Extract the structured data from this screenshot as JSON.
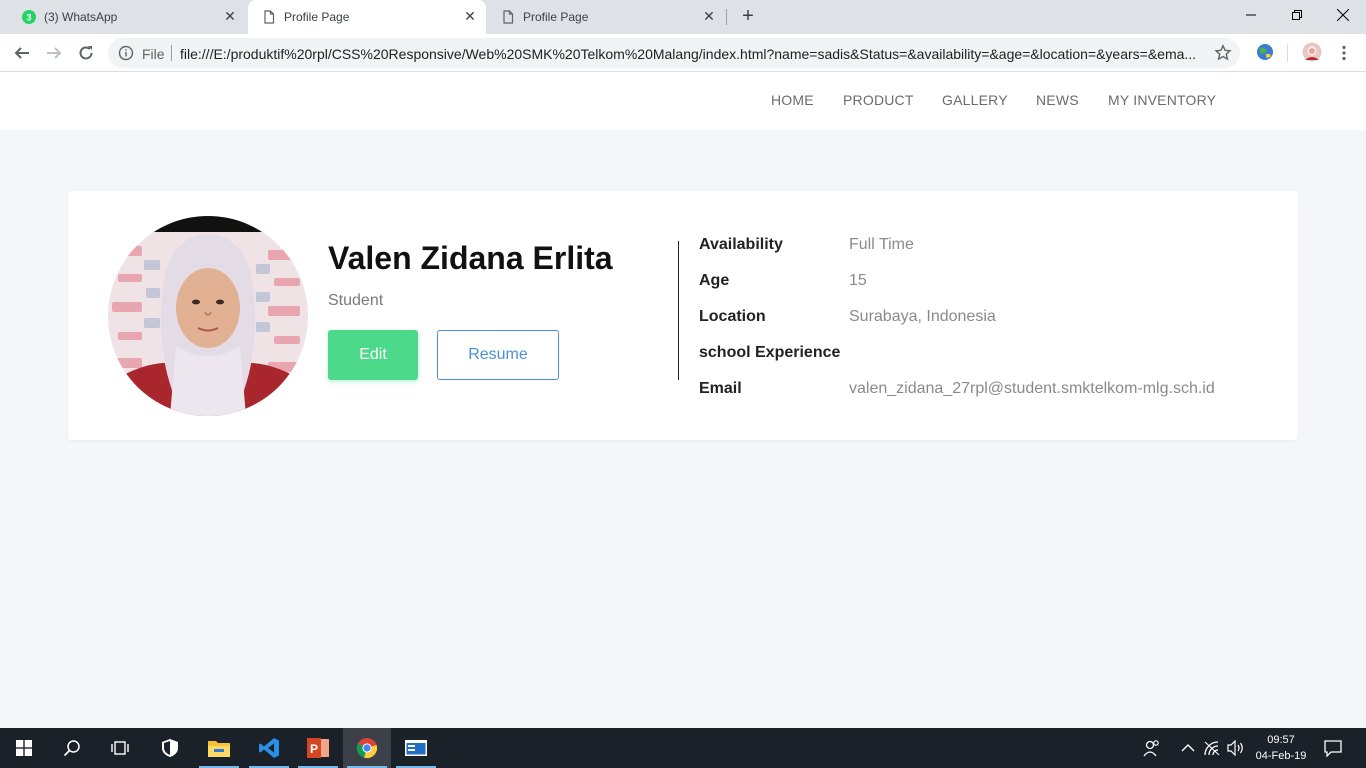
{
  "browser": {
    "tabs": [
      {
        "label": "(3) WhatsApp",
        "badge": "3",
        "active": false
      },
      {
        "label": "Profile Page",
        "active": true
      },
      {
        "label": "Profile Page",
        "active": false
      }
    ],
    "address": {
      "scheme_label": "File",
      "url": "file:///E:/produktif%20rpl/CSS%20Responsive/Web%20SMK%20Telkom%20Malang/index.html?name=sadis&Status=&availability=&age=&location=&years=&ema..."
    },
    "window_controls": [
      "minimize-icon",
      "restore-icon",
      "close-icon"
    ]
  },
  "nav": {
    "links": [
      "HOME",
      "PRODUCT",
      "GALLERY",
      "NEWS",
      "MY INVENTORY"
    ]
  },
  "profile": {
    "name": "Valen Zidana Erlita",
    "role": "Student",
    "edit_label": "Edit",
    "resume_label": "Resume",
    "info": [
      {
        "label": "Availability",
        "value": "Full Time"
      },
      {
        "label": "Age",
        "value": "15"
      },
      {
        "label": "Location",
        "value": "Surabaya, Indonesia"
      },
      {
        "label": "school Experience",
        "value": ""
      },
      {
        "label": "Email",
        "value": "valen_zidana_27rpl@student.smktelkom-mlg.sch.id"
      }
    ]
  },
  "taskbar": {
    "apps": [
      "windows-start-icon",
      "search-icon",
      "task-view-icon",
      "windows-security-icon",
      "file-explorer-icon",
      "vscode-icon",
      "powerpoint-icon",
      "chrome-icon",
      "terminal-icon"
    ],
    "time": "09:57",
    "date": "04-Feb-19"
  },
  "colors": {
    "accent_green": "#4cd98a",
    "accent_blue": "#4a90d9",
    "page_bg": "#f5f6fa",
    "taskbar_bg": "#1b2129"
  }
}
